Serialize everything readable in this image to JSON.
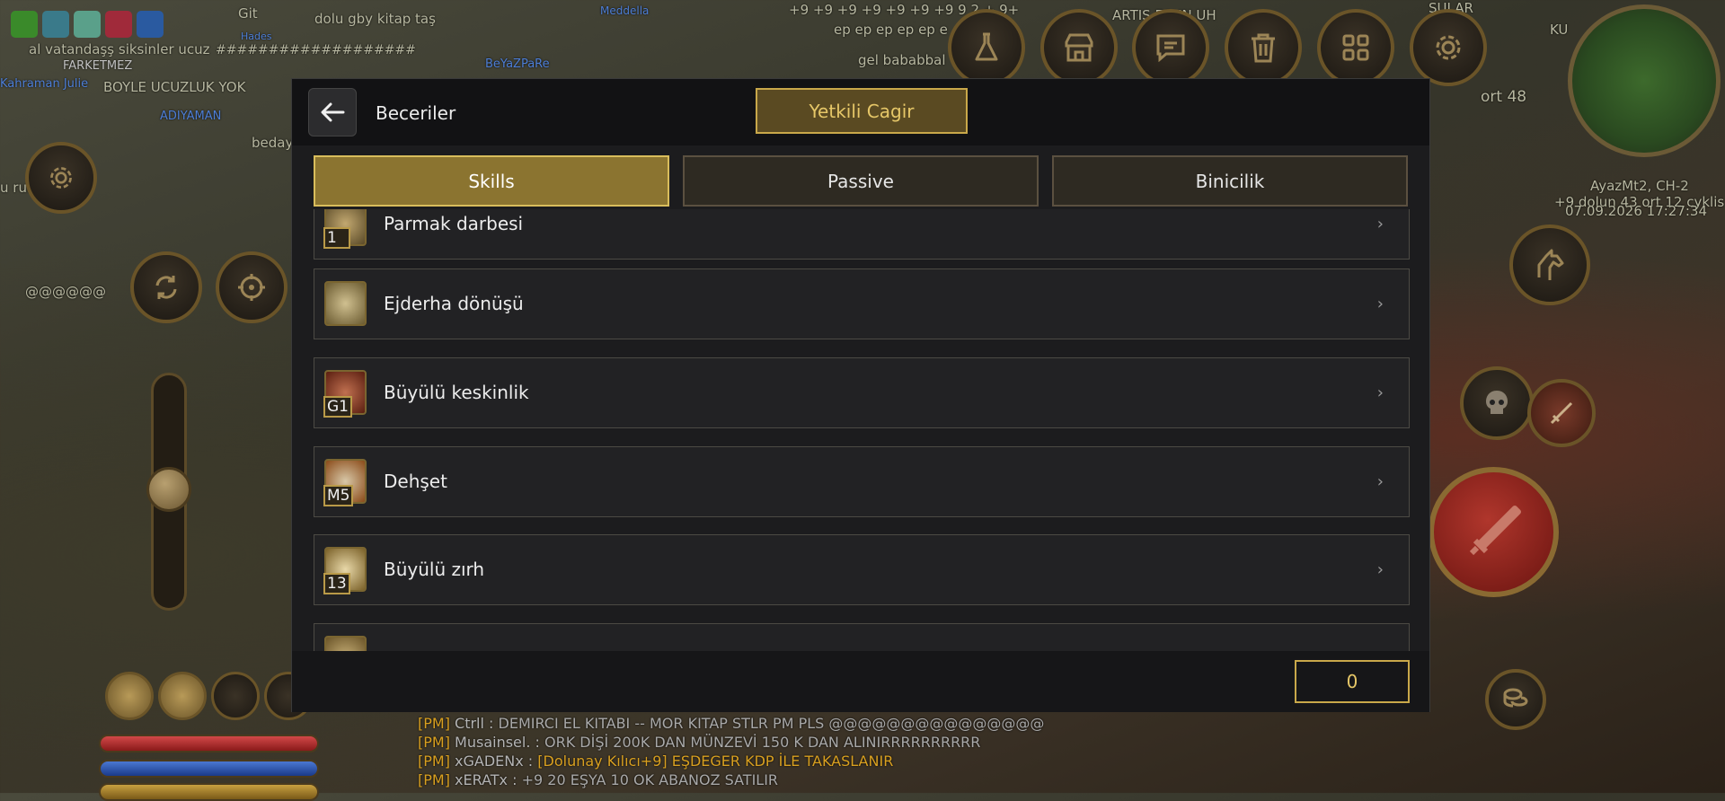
{
  "background": {
    "floating_texts": [
      "Git",
      "dolu gby kitap taş",
      "al vatandaşş  siksinler ucuz",
      "BOYLE UCUZLUK  YOK",
      "beday",
      "u rui",
      "@@@@@@",
      "+9 +9 +9 +9 +9 +9 +9 9  2 + 9+",
      "ep ep ep ep ep e",
      "gel bababbal",
      "ARTIS       ESUN       UH",
      "ort 48",
      "###################",
      "SULAR",
      "KU"
    ],
    "player_names": [
      "FARKETMEZ",
      "Kahraman Julie",
      "ADIYAMAN",
      "BeYaZPaRe",
      "Hades",
      "Meddella"
    ],
    "server_info": "AyazMt2, CH-2",
    "server_sub": "+9 dolun 43 ort 12 cyklis",
    "datetime": "07.09.2026 17:27:34",
    "chat": [
      {
        "tag": "[PM]",
        "sender": "Ctrll :",
        "message": "DEMIRCI EL KITABI -- MOR KITAP STLR PM PLS @@@@@@@@@@@@@@@"
      },
      {
        "tag": "[PM]",
        "sender": "Musainsel. :",
        "message": "ORK DİŞİ 200K DAN MÜNZEVİ 150 K DAN ALINIRRRRRRRRRR"
      },
      {
        "tag": "[PM]",
        "sender": "xGADENx :",
        "message": "[Dolunay Kılıcı+9] EŞDEGER KDP İLE TAKASLANIR"
      },
      {
        "tag": "[PM]",
        "sender": "xERATx :",
        "message": "+9 20 EŞYA 10 OK ABANOZ SATILIR"
      }
    ],
    "top_buttons": [
      "flask-icon",
      "shop-icon",
      "chat-icon",
      "trash-icon",
      "grid-icon",
      "gear-icon"
    ]
  },
  "dialog": {
    "title": "Beceriler",
    "action_button": "Yetkili Cagir",
    "tabs": [
      {
        "label": "Skills",
        "active": true
      },
      {
        "label": "Passive",
        "active": false
      },
      {
        "label": "Binicilik",
        "active": false
      }
    ],
    "skills": [
      {
        "name": "Parmak darbesi",
        "level": "1",
        "icon": "finger-strike-icon",
        "color": "#8a7a4a"
      },
      {
        "name": "Ejderha dönüşü",
        "level": "",
        "icon": "dragon-swirl-icon",
        "color": "#8f8050"
      },
      {
        "name": "Büyülü keskinlik",
        "level": "G1",
        "icon": "magic-sword-icon",
        "color": "#8a3a1e"
      },
      {
        "name": "Dehşet",
        "level": "M5",
        "icon": "skull-icon",
        "color": "#9a5a22"
      },
      {
        "name": "Büyülü zırh",
        "level": "13",
        "icon": "armor-icon",
        "color": "#8a7030"
      },
      {
        "name": "",
        "level": "",
        "icon": "partial-skill-icon",
        "color": "#7a6a40"
      }
    ],
    "skill_points": "0"
  },
  "colors": {
    "accent_gold": "#c9a84a",
    "active_tab": "#8b7430",
    "panel_bg": "#1c1c1e"
  }
}
